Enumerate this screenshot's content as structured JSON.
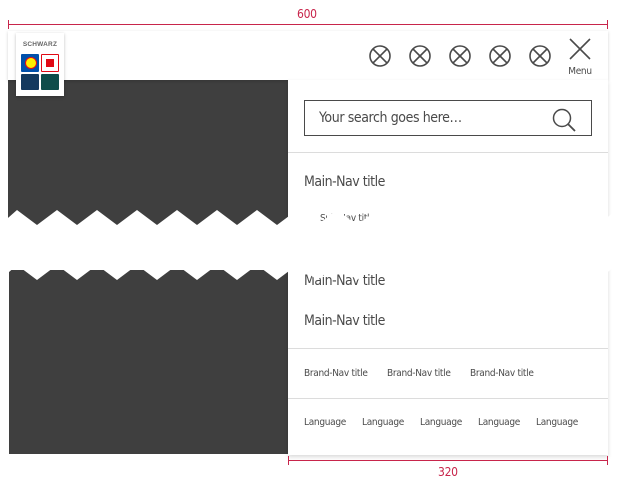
{
  "dimensions": {
    "total_width": "600",
    "panel_width": "320"
  },
  "logo": {
    "text": "SCHWARZ",
    "tiles": [
      "lidl",
      "kaufland",
      "schwarz-dunkel",
      "green"
    ]
  },
  "header": {
    "icon_buttons": [
      "icon-placeholder",
      "icon-placeholder",
      "icon-placeholder",
      "icon-placeholder",
      "icon-placeholder"
    ],
    "menu_label": "Menu"
  },
  "search": {
    "placeholder": "Your search goes here…"
  },
  "nav": {
    "main_1": "Main-Nav title",
    "sub_1": "Sub-Nav title",
    "main_2": "Main-Nav title",
    "main_3": "Main-Nav title"
  },
  "brands": [
    "Brand-Nav title",
    "Brand-Nav title",
    "Brand-Nav title"
  ],
  "languages": [
    "Language",
    "Language",
    "Language",
    "Language",
    "Language"
  ],
  "colors": {
    "accent": "#c8254b",
    "overlay": "#3f3f3f",
    "text": "#4a4a4a"
  }
}
